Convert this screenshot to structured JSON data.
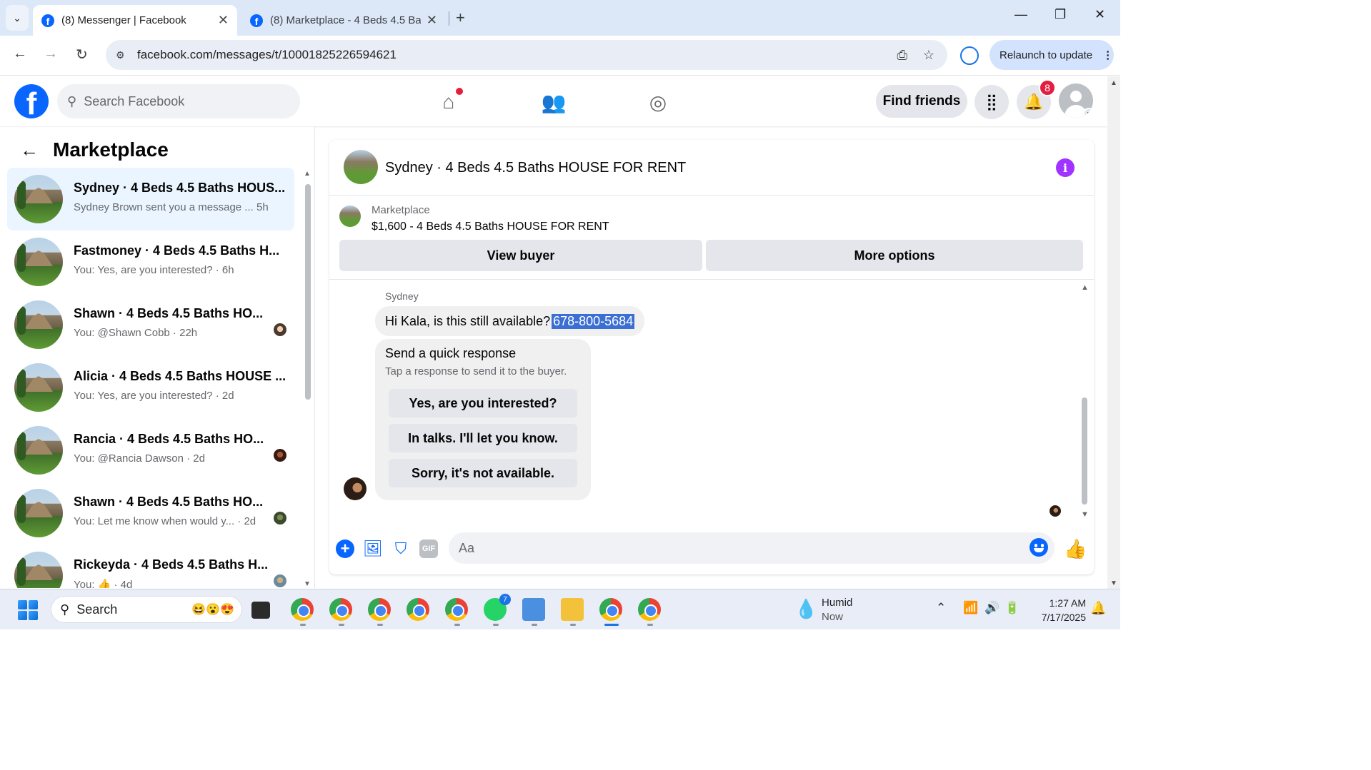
{
  "browser": {
    "tabs": [
      {
        "title": "(8) Messenger | Facebook",
        "active": true
      },
      {
        "title": "(8) Marketplace - 4 Beds 4.5 Bat",
        "active": false
      }
    ],
    "url": "facebook.com/messages/t/10001825226594621",
    "relaunch_label": "Relaunch to update"
  },
  "fb_header": {
    "search_placeholder": "Search Facebook",
    "find_friends_label": "Find friends",
    "notification_count": "8"
  },
  "sidebar": {
    "title": "Marketplace",
    "conversations": [
      {
        "name": "Sydney · 4 Beds 4.5 Baths HOUS...",
        "message": "Sydney Brown sent you a message ...",
        "time": "5h",
        "active": true
      },
      {
        "name": "Fastmoney · 4 Beds 4.5 Baths H...",
        "message": "You: Yes, are you interested? · 6h",
        "time": ""
      },
      {
        "name": "Shawn · 4 Beds 4.5 Baths HO...",
        "message": "You: @Shawn Cobb · 22h",
        "time": ""
      },
      {
        "name": "Alicia · 4 Beds 4.5 Baths HOUSE ...",
        "message": "You: Yes, are you interested? · 2d",
        "time": ""
      },
      {
        "name": "Rancia · 4 Beds 4.5 Baths HO...",
        "message": "You: @Rancia Dawson · 2d",
        "time": ""
      },
      {
        "name": "Shawn · 4 Beds 4.5 Baths HO...",
        "message": "You: Let me know when would y...  · 2d",
        "time": ""
      },
      {
        "name": "Rickeyda · 4 Beds 4.5 Baths H...",
        "message": "You: 👍 · 4d",
        "time": ""
      }
    ]
  },
  "chat": {
    "title": "Sydney · 4 Beds 4.5 Baths HOUSE FOR RENT",
    "marketplace_label": "Marketplace",
    "listing": "$1,600 - 4 Beds 4.5 Baths HOUSE FOR RENT",
    "view_buyer_label": "View buyer",
    "more_options_label": "More options",
    "sender": "Sydney",
    "message_text": "Hi Kala, is this still available?",
    "message_phone": "678-800-5684",
    "quick_title": "Send a quick response",
    "quick_subtitle": "Tap a response to send it to the buyer.",
    "quick_replies": [
      "Yes, are you interested?",
      "In talks. I'll let you know.",
      "Sorry, it's not available."
    ],
    "composer_placeholder": "Aa"
  },
  "taskbar": {
    "search_placeholder": "Search",
    "weather_title": "Humid",
    "weather_sub": "Now",
    "time": "1:27 AM",
    "date": "7/17/2025",
    "whatsapp_badge": "7"
  },
  "colors": {
    "fb_blue": "#0866ff",
    "notification_red": "#e41e3f",
    "info_purple": "#a033ff",
    "selection_blue": "#3b6fd4"
  }
}
